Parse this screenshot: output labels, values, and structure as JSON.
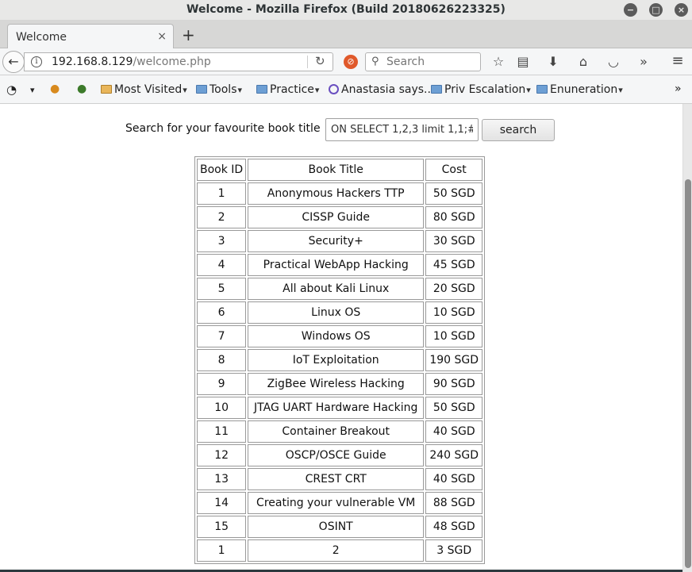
{
  "window": {
    "title": "Welcome - Mozilla Firefox (Build 20180626223325)",
    "minimize_icon": "minimize-icon",
    "maximize_icon": "maximize-icon",
    "close_icon": "close-icon"
  },
  "tabs": [
    {
      "title": "Welcome",
      "close": "×"
    }
  ],
  "new_tab": "+",
  "navbar": {
    "url_host": "192.168.8.129",
    "url_path": "/welcome.php",
    "search_placeholder": "Search",
    "overflow": "»",
    "menu": "≡"
  },
  "bookmarks": [
    {
      "label": "Most Visited",
      "icon": "most-visited-icon",
      "dropdown": true
    },
    {
      "label": "Tools",
      "icon": "folder-icon",
      "dropdown": true
    },
    {
      "label": "Practice",
      "icon": "folder-icon",
      "dropdown": true
    },
    {
      "label": "Anastasia says...",
      "icon": "bookmark-icon",
      "dropdown": false
    },
    {
      "label": "Priv Escalation",
      "icon": "folder-icon",
      "dropdown": true
    },
    {
      "label": "Enuneration",
      "icon": "folder-icon",
      "dropdown": true
    }
  ],
  "bookmarks_overflow": "»",
  "page": {
    "search_label": "Search for your favourite book title",
    "search_value": "ON SELECT 1,2,3 limit 1,1;#",
    "search_button": "search",
    "table_headers": [
      "Book ID",
      "Book Title",
      "Cost"
    ],
    "rows": [
      [
        "1",
        "Anonymous Hackers TTP",
        "50 SGD"
      ],
      [
        "2",
        "CISSP Guide",
        "80 SGD"
      ],
      [
        "3",
        "Security+",
        "30 SGD"
      ],
      [
        "4",
        "Practical WebApp Hacking",
        "45 SGD"
      ],
      [
        "5",
        "All about Kali Linux",
        "20 SGD"
      ],
      [
        "6",
        "Linux OS",
        "10 SGD"
      ],
      [
        "7",
        "Windows OS",
        "10 SGD"
      ],
      [
        "8",
        "IoT Exploitation",
        "190 SGD"
      ],
      [
        "9",
        "ZigBee Wireless Hacking",
        "90 SGD"
      ],
      [
        "10",
        "JTAG UART Hardware Hacking",
        "50 SGD"
      ],
      [
        "11",
        "Container Breakout",
        "40 SGD"
      ],
      [
        "12",
        "OSCP/OSCE Guide",
        "240 SGD"
      ],
      [
        "13",
        "CREST CRT",
        "40 SGD"
      ],
      [
        "14",
        "Creating your vulnerable VM",
        "88 SGD"
      ],
      [
        "15",
        "OSINT",
        "48 SGD"
      ],
      [
        "1",
        "2",
        "3 SGD"
      ]
    ]
  }
}
